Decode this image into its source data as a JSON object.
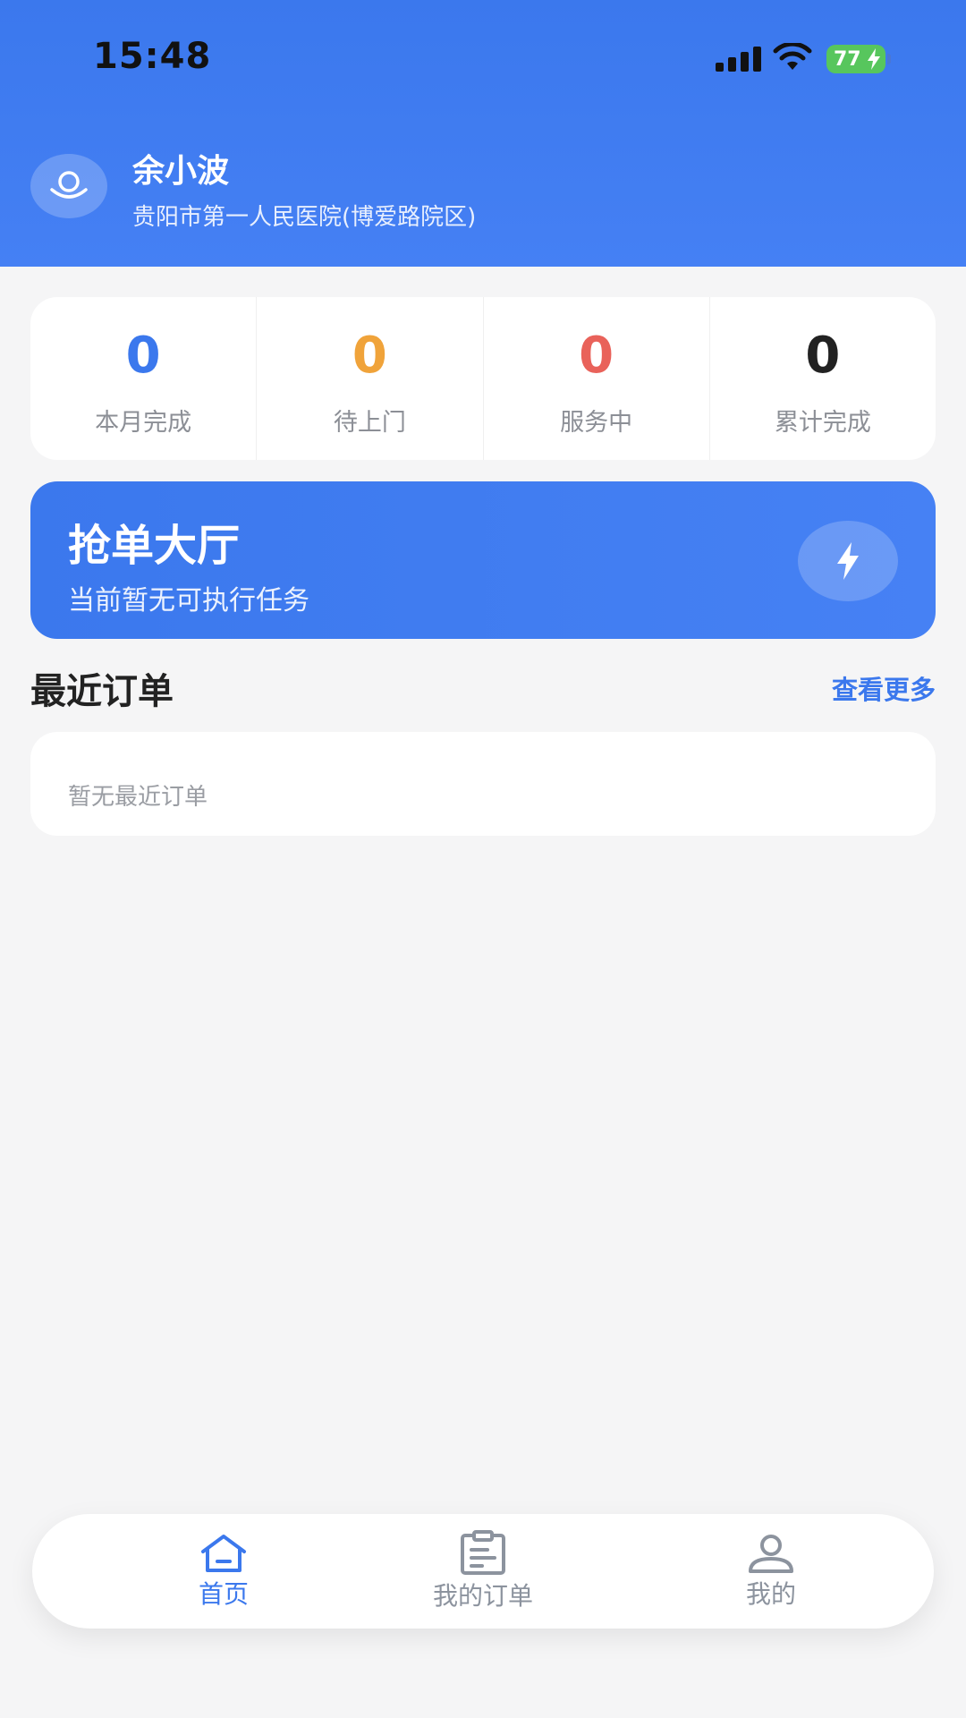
{
  "status_bar": {
    "time": "15:48",
    "battery": "77",
    "icons": [
      "signal-icon",
      "wifi-icon",
      "battery-charging-icon"
    ]
  },
  "user": {
    "name": "余小波",
    "hospital": "贵阳市第一人民医院(博爱路院区)",
    "avatar_icon": "avatar-icon"
  },
  "stats": [
    {
      "value": "0",
      "label": "本月完成",
      "color": "#3b78ed"
    },
    {
      "value": "0",
      "label": "待上门",
      "color": "#f0a33a"
    },
    {
      "value": "0",
      "label": "服务中",
      "color": "#e9625a"
    },
    {
      "value": "0",
      "label": "累计完成",
      "color": "#222222"
    }
  ],
  "hall": {
    "title": "抢单大厅",
    "subtitle": "当前暂无可执行任务",
    "icon": "lightning-icon"
  },
  "recent_orders": {
    "title": "最近订单",
    "more": "查看更多",
    "empty_text": "暂无最近订单"
  },
  "tabbar": {
    "items": [
      {
        "label": "首页",
        "icon": "home-icon",
        "active": true
      },
      {
        "label": "我的订单",
        "icon": "clipboard-icon",
        "active": false
      },
      {
        "label": "我的",
        "icon": "user-icon",
        "active": false
      }
    ],
    "active_color": "#3b78ed",
    "inactive_color": "#8c939e"
  }
}
